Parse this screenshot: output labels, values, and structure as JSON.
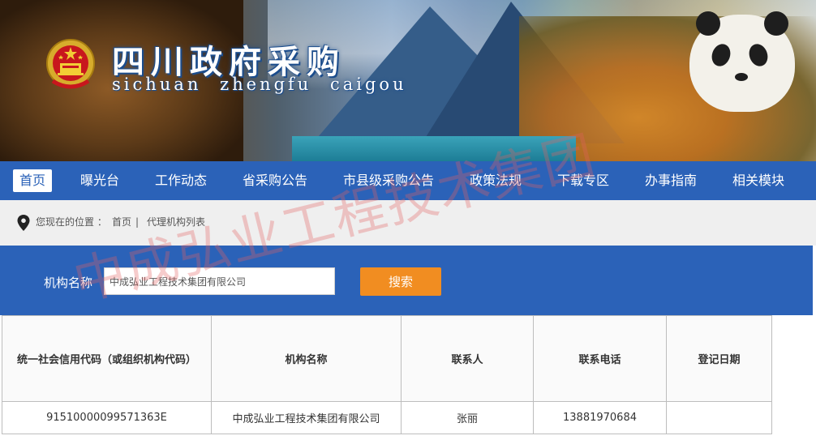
{
  "header": {
    "title": "四川政府采购",
    "subtitle": "sichuan zhengfu caigou",
    "emblem_icon": "national-emblem-icon"
  },
  "nav": {
    "items": [
      {
        "label": "首页",
        "active": true
      },
      {
        "label": "曝光台"
      },
      {
        "label": "工作动态"
      },
      {
        "label": "省采购公告"
      },
      {
        "label": "市县级采购公告"
      },
      {
        "label": "政策法规"
      },
      {
        "label": "下载专区"
      },
      {
        "label": "办事指南"
      },
      {
        "label": "相关模块"
      }
    ]
  },
  "breadcrumb": {
    "icon": "location-pin-icon",
    "prefix": "您现在的位置 ：",
    "home": "首页",
    "separator": "|",
    "current": "代理机构列表"
  },
  "search": {
    "label": "机构名称",
    "value": "中成弘业工程技术集团有限公司",
    "button_label": "搜索"
  },
  "table": {
    "headers": [
      "统一社会信用代码（或组织机构代码）",
      "机构名称",
      "联系人",
      "联系电话",
      "登记日期"
    ],
    "rows": [
      [
        "91510000099571363E",
        "中成弘业工程技术集团有限公司",
        "张丽",
        "13881970684",
        ""
      ]
    ]
  },
  "watermark": "中成弘业工程技术集团",
  "colors": {
    "nav_blue": "#2b62b8",
    "button_orange": "#f18d21",
    "watermark_red": "#e46060"
  }
}
